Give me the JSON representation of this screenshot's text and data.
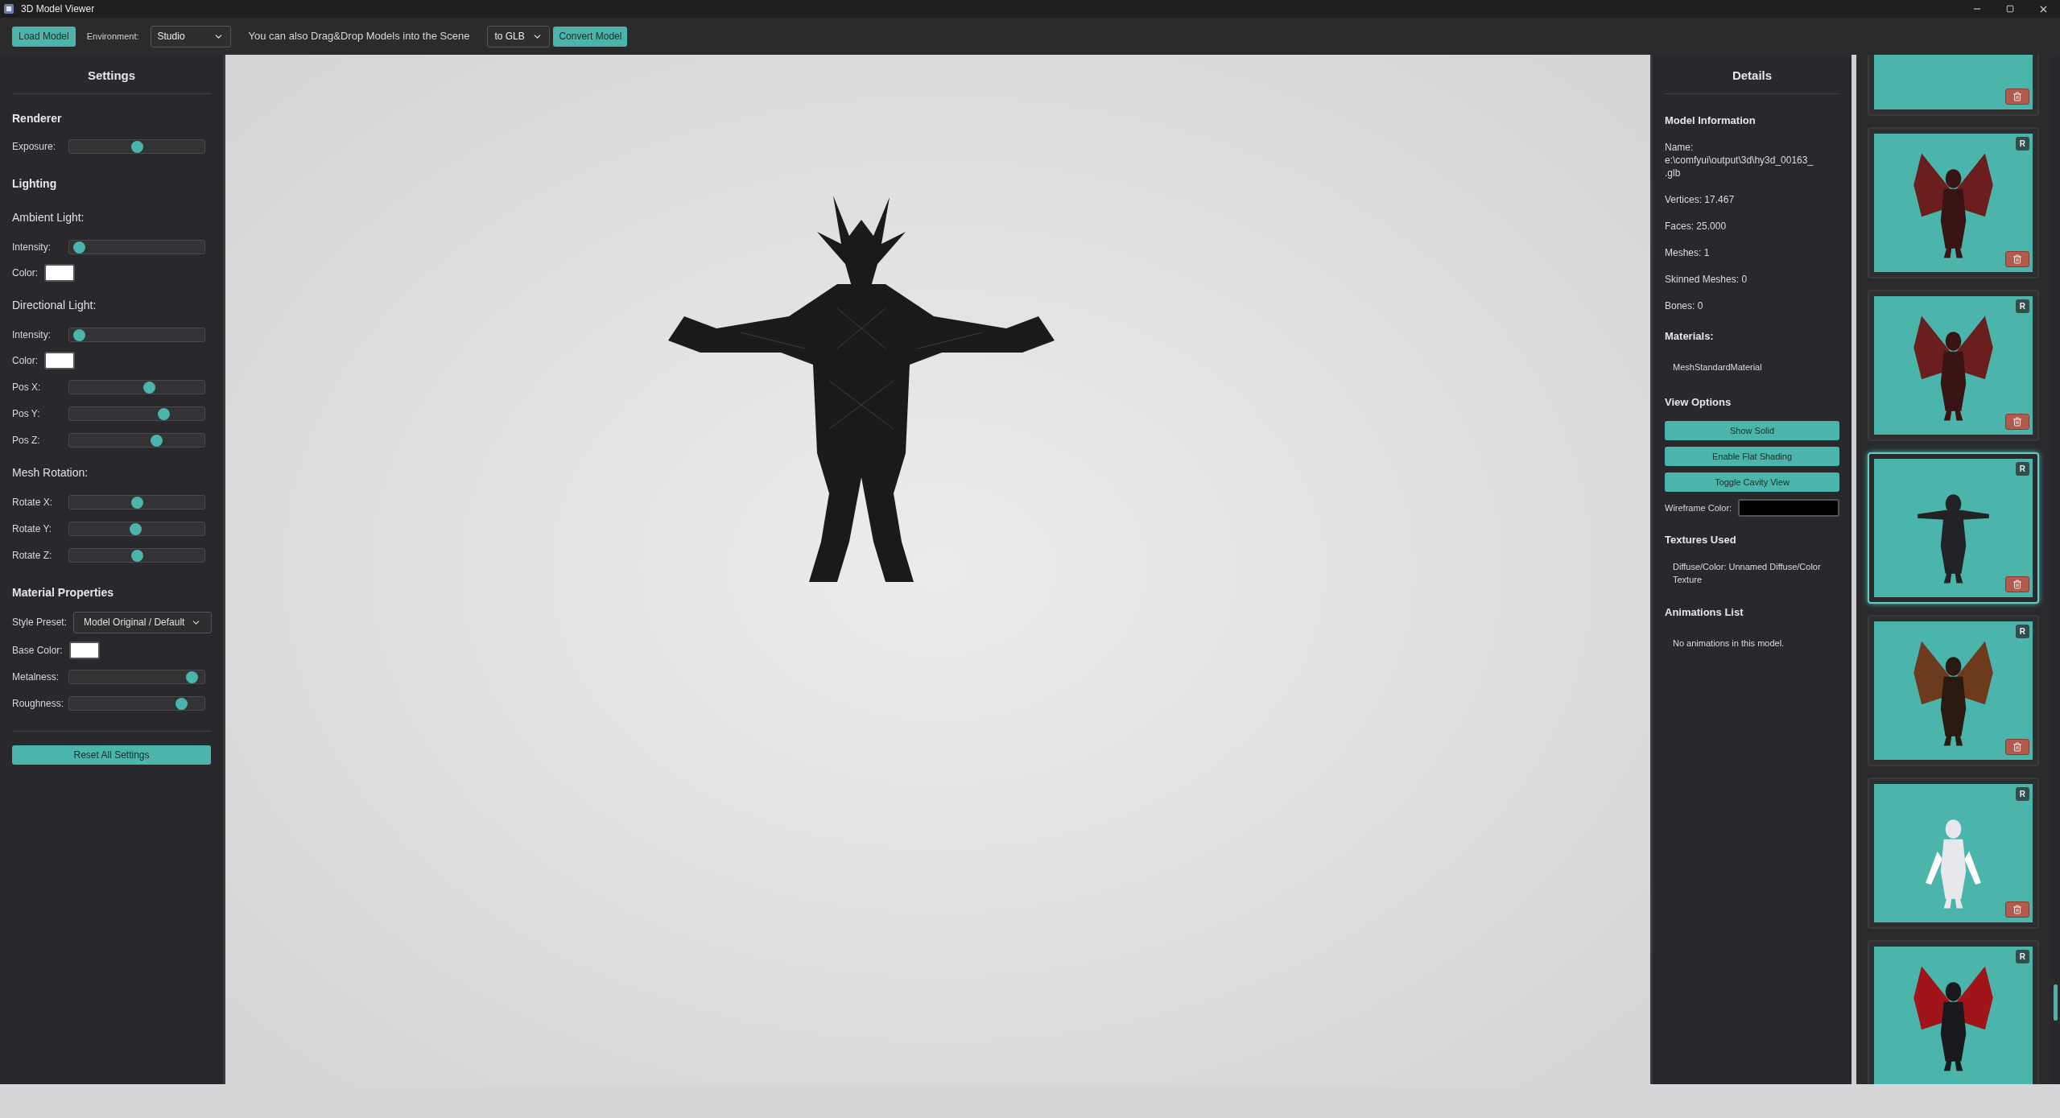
{
  "window": {
    "title": "3D Model Viewer"
  },
  "toolbar": {
    "load_button": "Load Model",
    "environment_label": "Environment:",
    "environment": "Studio",
    "hint": "You can also Drag&Drop Models into the Scene",
    "format": "to GLB",
    "convert_button": "Convert Model"
  },
  "settings": {
    "title": "Settings",
    "sections": [
      {
        "heading": "Renderer",
        "rows": [
          {
            "kind": "slider",
            "label": "Exposure:",
            "level": 0.5
          }
        ]
      },
      {
        "heading": "Lighting",
        "rows": [
          {
            "kind": "subheading",
            "label": "Ambient Light:"
          },
          {
            "kind": "slider",
            "label": "Intensity:",
            "level": 0.03
          },
          {
            "kind": "color",
            "label": "Color:",
            "color": "#ffffff"
          },
          {
            "kind": "subheading",
            "label": "Directional Light:"
          },
          {
            "kind": "slider",
            "label": "Intensity:",
            "level": 0.03
          },
          {
            "kind": "color",
            "label": "Color:",
            "color": "#ffffff"
          },
          {
            "kind": "slider",
            "label": "Pos X:",
            "level": 0.6
          },
          {
            "kind": "slider",
            "label": "Pos Y:",
            "level": 0.72
          },
          {
            "kind": "slider",
            "label": "Pos Z:",
            "level": 0.66
          },
          {
            "kind": "subheading",
            "label": "Mesh Rotation:"
          },
          {
            "kind": "slider",
            "label": "Rotate X:",
            "level": 0.5
          },
          {
            "kind": "slider",
            "label": "Rotate Y:",
            "level": 0.49
          },
          {
            "kind": "slider",
            "label": "Rotate Z:",
            "level": 0.5
          }
        ]
      },
      {
        "heading": "Material Properties",
        "rows": [
          {
            "kind": "select",
            "label": "Style Preset:",
            "value": "Model Original / Default"
          },
          {
            "kind": "color",
            "label": "Base Color:",
            "color": "#ffffff"
          },
          {
            "kind": "slider",
            "label": "Metalness:",
            "level": 0.95
          },
          {
            "kind": "slider",
            "label": "Roughness:",
            "level": 0.86
          }
        ]
      }
    ],
    "reset_button": "Reset All Settings"
  },
  "details": {
    "title": "Details",
    "model_heading": "Model Information",
    "info": [
      "Name:\ne:\\comfyui\\output\\3d\\hy3d_00163_\n.glb",
      "Vertices: 17.467",
      "Faces: 25.000",
      "Meshes: 1",
      "Skinned Meshes: 0",
      "Bones: 0"
    ],
    "materials_heading": "Materials:",
    "materials": [
      "MeshStandardMaterial"
    ],
    "view_heading": "View Options",
    "view_buttons": [
      "Show Solid",
      "Enable Flat Shading",
      "Toggle Cavity View"
    ],
    "wireframe": {
      "label": "Wireframe Color:",
      "color": "#000000"
    },
    "textures_heading": "Textures Used",
    "textures": [
      "Diffuse/Color: Unnamed Diffuse/Color Texture"
    ],
    "animations_heading": "Animations List",
    "animations_note": "No animations in this model."
  },
  "models": [
    {
      "kind": "picture",
      "selected": false,
      "trash": true
    },
    {
      "kind": "picture",
      "badge": "R",
      "selected": false,
      "trash": true
    },
    {
      "kind": "picture",
      "badge": "R",
      "selected": false,
      "trash": true
    },
    {
      "kind": "picture",
      "badge": "R",
      "selected": true,
      "trash": true
    },
    {
      "kind": "picture",
      "badge": "R",
      "selected": false,
      "trash": true
    },
    {
      "kind": "picture",
      "badge": "R",
      "selected": false,
      "trash": true
    },
    {
      "kind": "picture",
      "badge": "R",
      "selected": false,
      "trash": false
    }
  ]
}
